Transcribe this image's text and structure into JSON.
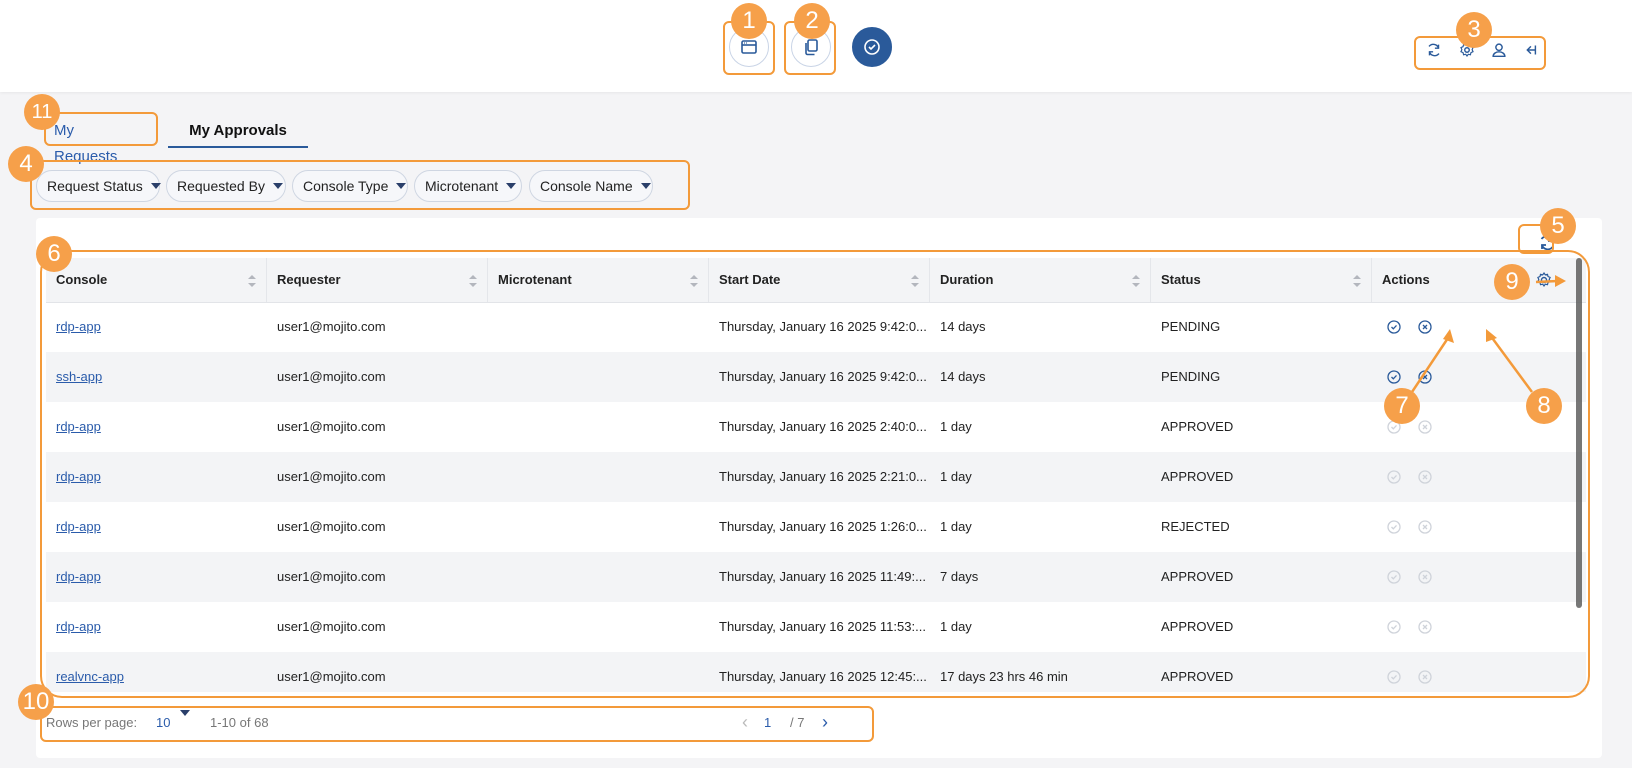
{
  "topbar": {
    "center_buttons": [
      {
        "icon": "window-icon"
      },
      {
        "icon": "copy-icon"
      },
      {
        "icon": "check-circle-icon",
        "active": true
      }
    ],
    "right_icons": [
      "refresh-icon",
      "gear-icon",
      "user-icon",
      "logout-icon"
    ]
  },
  "tabs": {
    "my_requests": "My Requests",
    "my_approvals": "My Approvals"
  },
  "filters": [
    "Request Status",
    "Requested By",
    "Console Type",
    "Microtenant",
    "Console Name"
  ],
  "table": {
    "columns": [
      "Console",
      "Requester",
      "Microtenant",
      "Start Date",
      "Duration",
      "Status",
      "Actions"
    ],
    "rows": [
      {
        "console": "rdp-app",
        "requester": "user1@mojito.com",
        "microtenant": "",
        "start": "Thursday, January 16 2025 9:42:0...",
        "duration": "14 days",
        "status": "PENDING",
        "enabled": true
      },
      {
        "console": "ssh-app",
        "requester": "user1@mojito.com",
        "microtenant": "",
        "start": "Thursday, January 16 2025 9:42:0...",
        "duration": "14 days",
        "status": "PENDING",
        "enabled": true
      },
      {
        "console": "rdp-app",
        "requester": "user1@mojito.com",
        "microtenant": "",
        "start": "Thursday, January 16 2025 2:40:0...",
        "duration": "1 day",
        "status": "APPROVED",
        "enabled": false
      },
      {
        "console": "rdp-app",
        "requester": "user1@mojito.com",
        "microtenant": "",
        "start": "Thursday, January 16 2025 2:21:0...",
        "duration": "1 day",
        "status": "APPROVED",
        "enabled": false
      },
      {
        "console": "rdp-app",
        "requester": "user1@mojito.com",
        "microtenant": "",
        "start": "Thursday, January 16 2025 1:26:0...",
        "duration": "1 day",
        "status": "REJECTED",
        "enabled": false
      },
      {
        "console": "rdp-app",
        "requester": "user1@mojito.com",
        "microtenant": "",
        "start": "Thursday, January 16 2025 11:49:...",
        "duration": "7 days",
        "status": "APPROVED",
        "enabled": false
      },
      {
        "console": "rdp-app",
        "requester": "user1@mojito.com",
        "microtenant": "",
        "start": "Thursday, January 16 2025 11:53:...",
        "duration": "1 day",
        "status": "APPROVED",
        "enabled": false
      },
      {
        "console": "realvnc-app",
        "requester": "user1@mojito.com",
        "microtenant": "",
        "start": "Thursday, January 16 2025 12:45:...",
        "duration": "17 days 23 hrs 46 min",
        "status": "APPROVED",
        "enabled": false
      }
    ]
  },
  "pager": {
    "rows_label": "Rows per page:",
    "rows_value": "10",
    "range": "1-10 of 68",
    "page": "1",
    "total_pages": "/ 7"
  },
  "annotations": [
    "1",
    "2",
    "3",
    "4",
    "5",
    "6",
    "7",
    "8",
    "9",
    "10",
    "11"
  ],
  "colors": {
    "accent": "#2a5a9a",
    "link": "#2b5cab",
    "annotation": "#f39a3a"
  }
}
